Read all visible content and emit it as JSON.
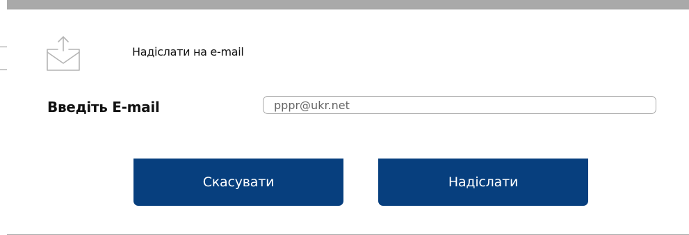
{
  "dialog": {
    "title": "Надіслати на e-mail",
    "icon": "envelope-upload-icon"
  },
  "form": {
    "email_label": "Введіть E-mail",
    "email_value": "pppr@ukr.net"
  },
  "buttons": {
    "cancel_label": "Скасувати",
    "send_label": "Надіслати"
  },
  "colors": {
    "button_bg": "#073f7e",
    "overlay": "#a9a9a9"
  }
}
